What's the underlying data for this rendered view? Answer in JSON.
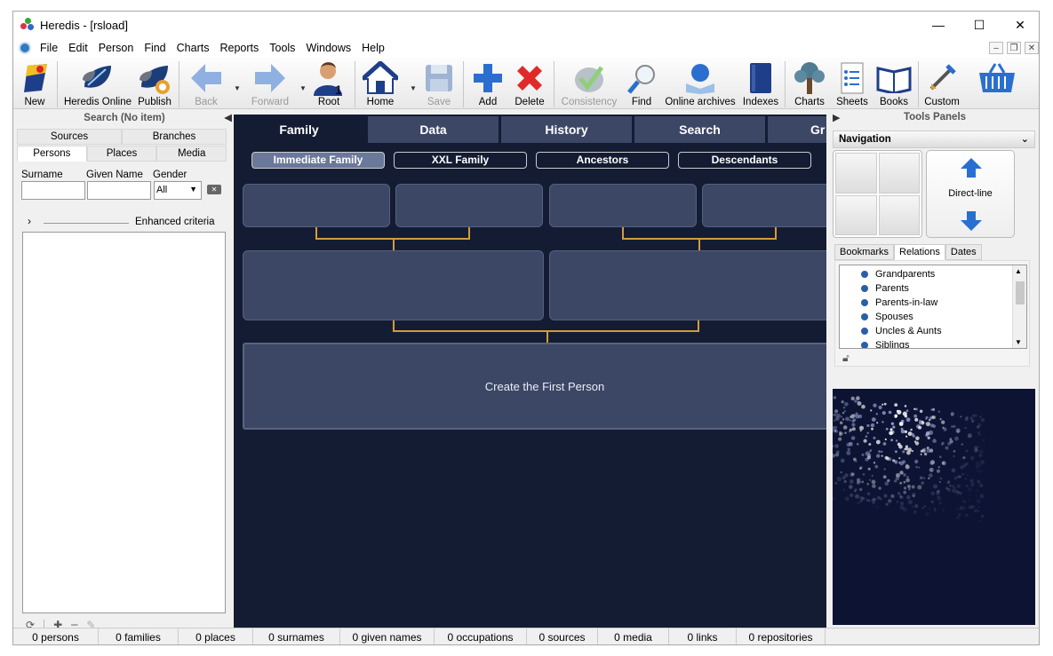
{
  "window": {
    "title": "Heredis - [rsload]",
    "min": "—",
    "max": "☐",
    "close": "✕"
  },
  "menu": [
    "File",
    "Edit",
    "Person",
    "Find",
    "Charts",
    "Reports",
    "Tools",
    "Windows",
    "Help"
  ],
  "toolbar": {
    "new": "New",
    "heredis_online": "Heredis Online",
    "publish": "Publish",
    "back": "Back",
    "forward": "Forward",
    "root": "Root",
    "home": "Home",
    "save": "Save",
    "add": "Add",
    "delete": "Delete",
    "consistency": "Consistency",
    "find": "Find",
    "online_archives": "Online archives",
    "indexes": "Indexes",
    "charts": "Charts",
    "sheets": "Sheets",
    "books": "Books",
    "custom": "Custom"
  },
  "search_panel": {
    "title": "Search (No item)",
    "tabs_top": [
      "Sources",
      "Branches"
    ],
    "tabs_bottom": [
      "Persons",
      "Places",
      "Media"
    ],
    "surname_label": "Surname",
    "given_label": "Given Name",
    "gender_label": "Gender",
    "gender_value": "All",
    "enhanced": "Enhanced criteria"
  },
  "center": {
    "tabs": [
      "Family",
      "Data",
      "History",
      "Search",
      "Gr"
    ],
    "subtabs": [
      "Immediate Family",
      "XXL Family",
      "Ancestors",
      "Descendants"
    ],
    "create_first": "Create the First Person"
  },
  "tools": {
    "title": "Tools Panels",
    "navigation": "Navigation",
    "direct_line": "Direct-line",
    "tabs": [
      "Bookmarks",
      "Relations",
      "Dates"
    ],
    "relations": [
      "Grandparents",
      "Parents",
      "Parents-in-law",
      "Spouses",
      "Uncles & Aunts",
      "Siblings"
    ]
  },
  "status": [
    "0 persons",
    "0 families",
    "0 places",
    "0 surnames",
    "0 given names",
    "0  occupations",
    "0 sources",
    "0  media",
    "0 links",
    "0 repositories"
  ],
  "colors": {
    "accent_blue": "#2a6fd0",
    "panel_dark": "#131c33",
    "box": "#3c4766",
    "connector": "#d49b3d"
  }
}
